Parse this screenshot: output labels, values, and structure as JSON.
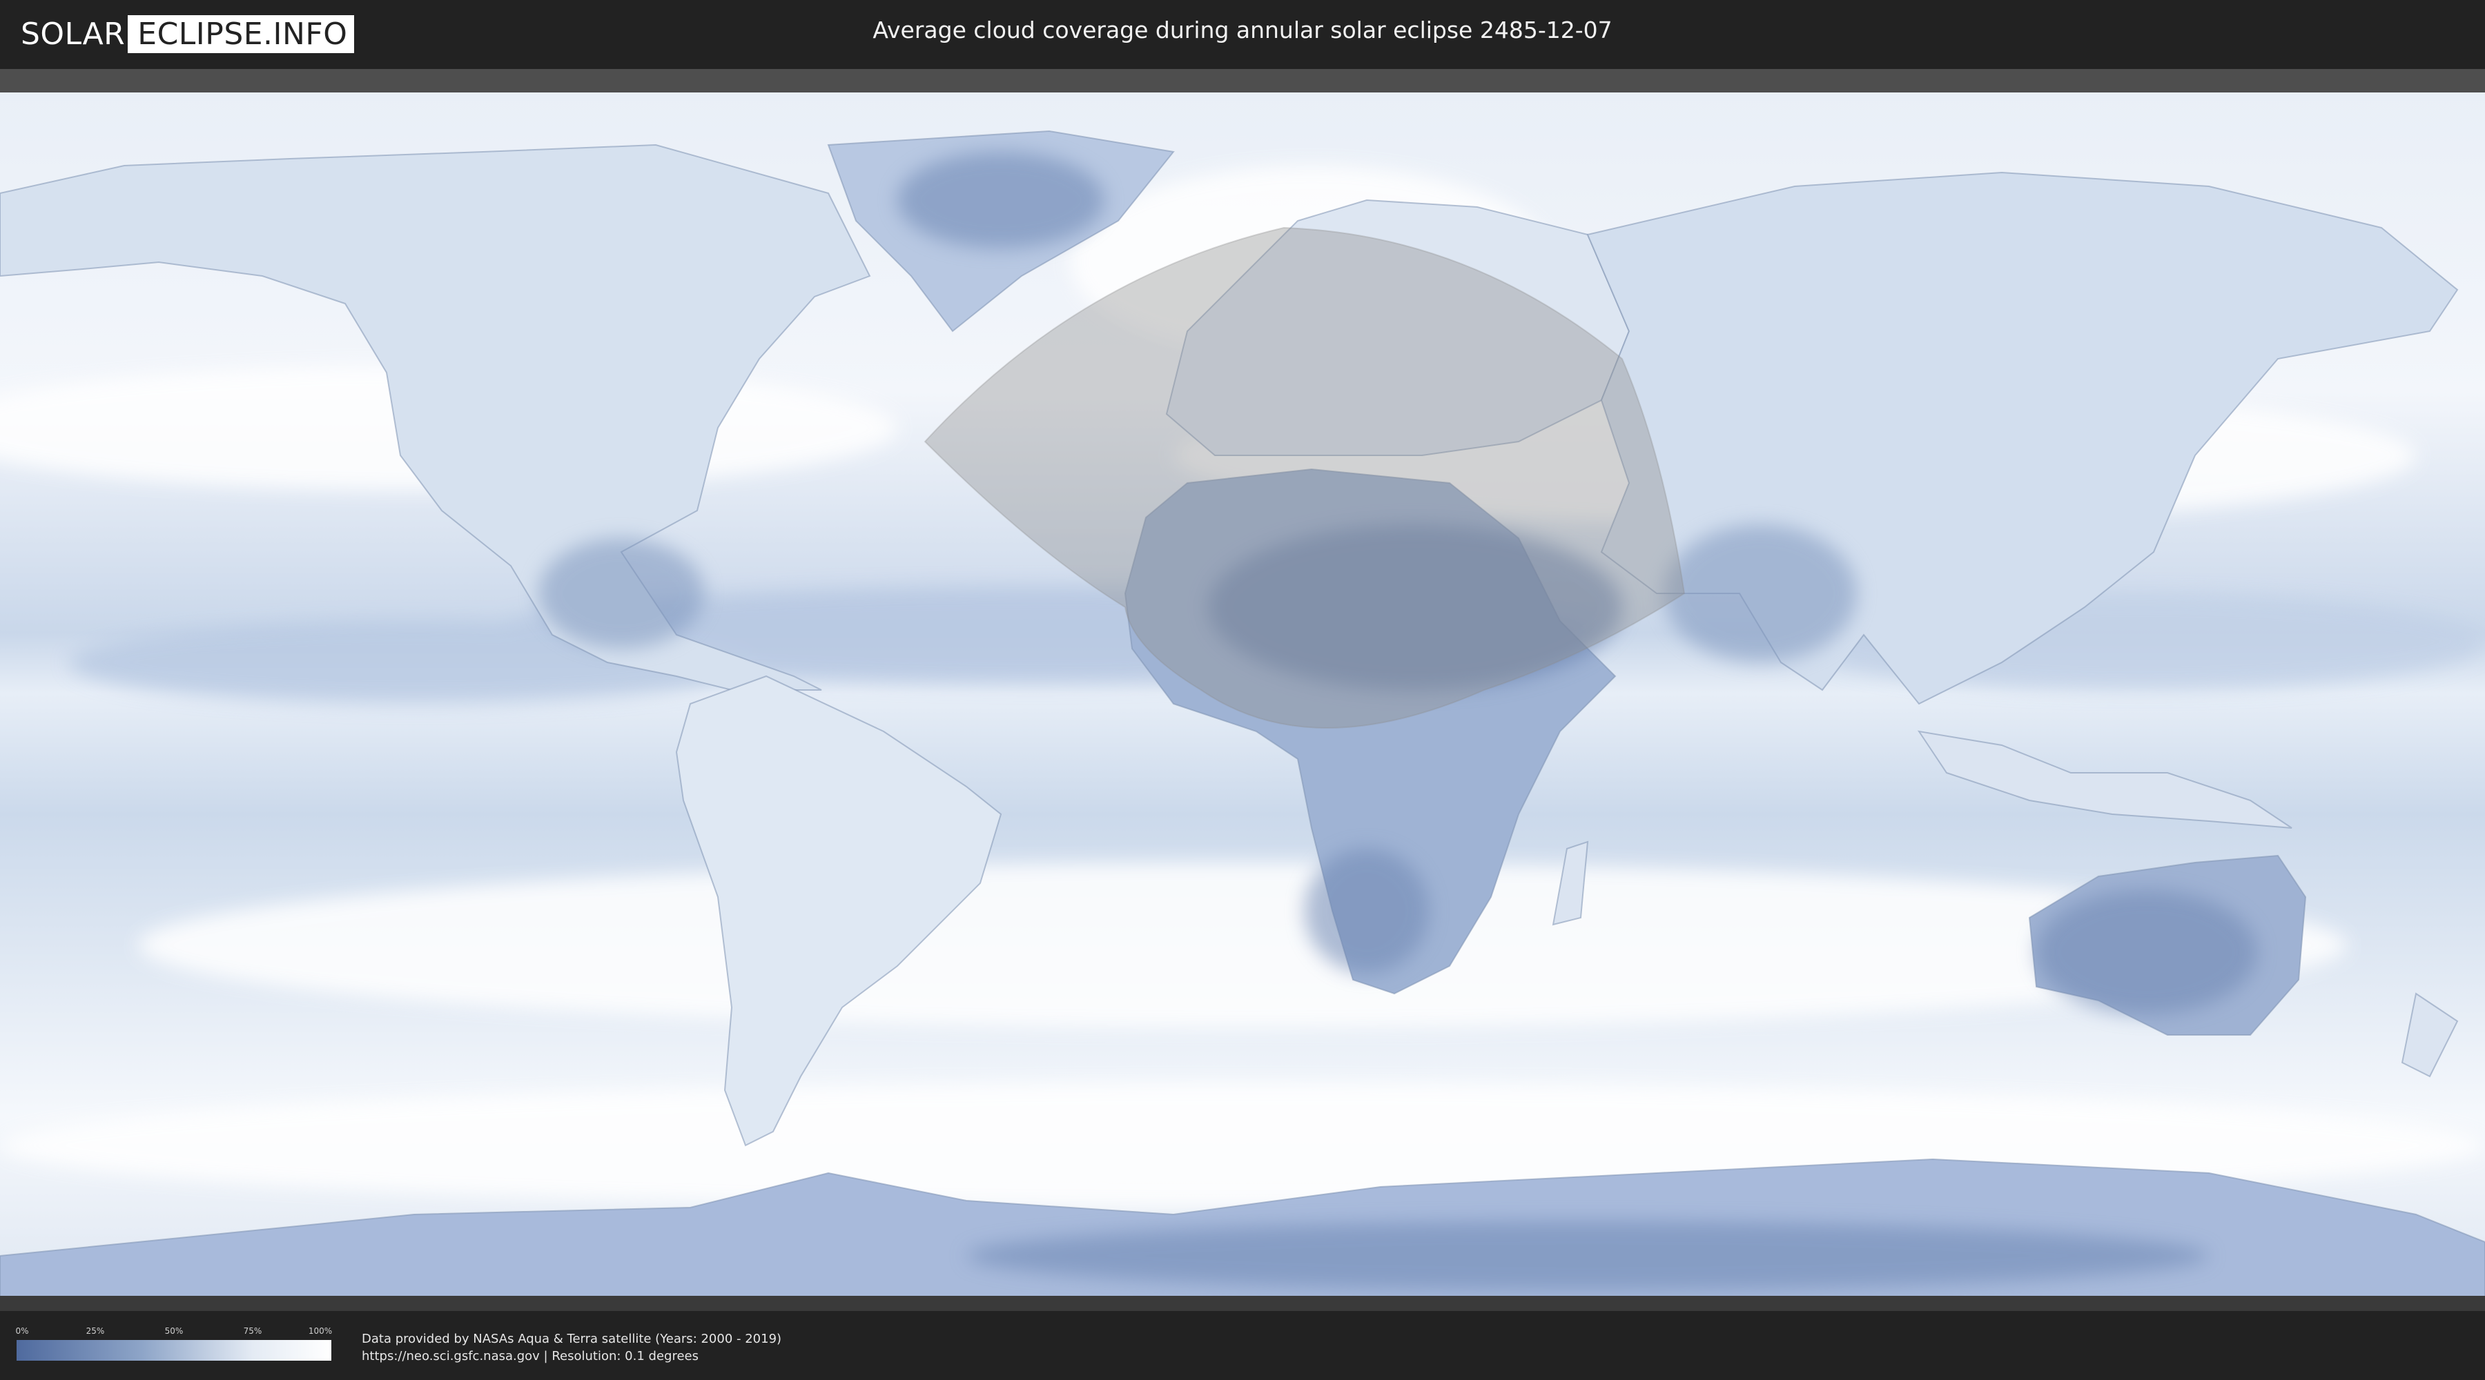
{
  "header": {
    "logo_part1": "SOLAR",
    "logo_part2": "ECLIPSE.INFO",
    "title": "Average cloud coverage during annular solar eclipse 2485-12-07"
  },
  "map": {
    "ocean_color": "#dde6f1",
    "cloud_color": "#f7f9fc",
    "clear_sky_color": "#7f98c2",
    "eclipse_overlay_color": "#9a9a9a"
  },
  "legend": {
    "ticks": [
      "0%",
      "25%",
      "50%",
      "75%",
      "100%"
    ]
  },
  "credits": {
    "line1": "Data provided by NASAs Aqua & Terra satellite (Years: 2000 - 2019)",
    "line2": "https://neo.sci.gsfc.nasa.gov | Resolution: 0.1 degrees"
  }
}
